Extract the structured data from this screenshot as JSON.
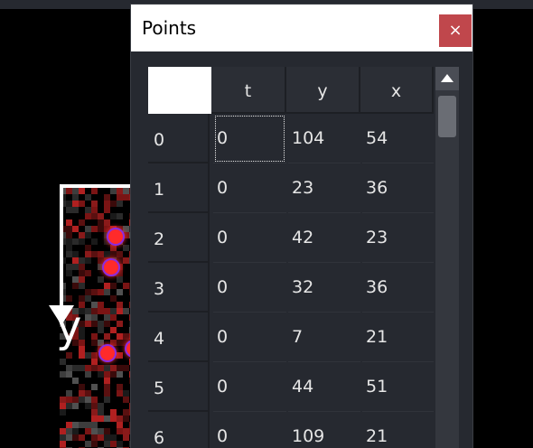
{
  "dialog": {
    "title": "Points",
    "close_label": "×"
  },
  "table": {
    "columns": [
      "t",
      "y",
      "x"
    ],
    "rows": [
      {
        "index": "0",
        "t": "0",
        "y": "104",
        "x": "54"
      },
      {
        "index": "1",
        "t": "0",
        "y": "23",
        "x": "36"
      },
      {
        "index": "2",
        "t": "0",
        "y": "42",
        "x": "23"
      },
      {
        "index": "3",
        "t": "0",
        "y": "32",
        "x": "36"
      },
      {
        "index": "4",
        "t": "0",
        "y": "7",
        "x": "21"
      },
      {
        "index": "5",
        "t": "0",
        "y": "44",
        "x": "51"
      },
      {
        "index": "6",
        "t": "0",
        "y": "109",
        "x": "21"
      }
    ],
    "selected_cell": "row 0, column t"
  },
  "viewer": {
    "axis_label": "y"
  },
  "colors": {
    "panel_bg": "#262930",
    "close_button": "#c0474c",
    "point_fill": "#ff2a2a",
    "point_edge": "#8a2be2"
  }
}
